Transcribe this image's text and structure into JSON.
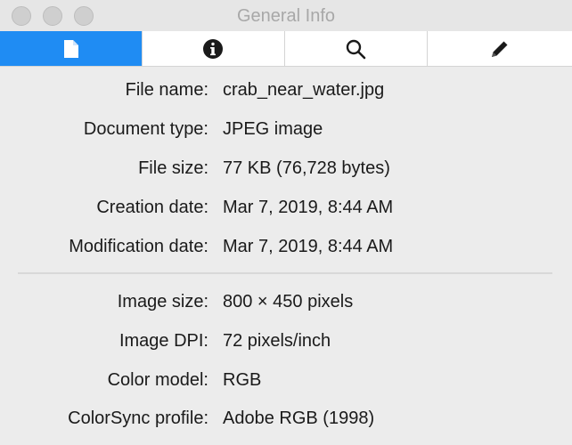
{
  "window": {
    "title": "General Info"
  },
  "toolbar": {
    "tabs": [
      {
        "icon": "document-icon",
        "active": true
      },
      {
        "icon": "info-icon",
        "active": false
      },
      {
        "icon": "search-icon",
        "active": false
      },
      {
        "icon": "pencil-icon",
        "active": false
      }
    ],
    "accent_color": "#1f8cf3"
  },
  "file_info": [
    {
      "label": "File name:",
      "value": "crab_near_water.jpg"
    },
    {
      "label": "Document type:",
      "value": "JPEG image"
    },
    {
      "label": "File size:",
      "value": "77 KB (76,728 bytes)"
    },
    {
      "label": "Creation date:",
      "value": "Mar 7, 2019, 8:44 AM"
    },
    {
      "label": "Modification date:",
      "value": "Mar 7, 2019, 8:44 AM"
    }
  ],
  "image_info": [
    {
      "label": "Image size:",
      "value": "800 × 450 pixels"
    },
    {
      "label": "Image DPI:",
      "value": "72 pixels/inch"
    },
    {
      "label": "Color model:",
      "value": "RGB"
    },
    {
      "label": "ColorSync profile:",
      "value": "Adobe RGB (1998)"
    }
  ]
}
